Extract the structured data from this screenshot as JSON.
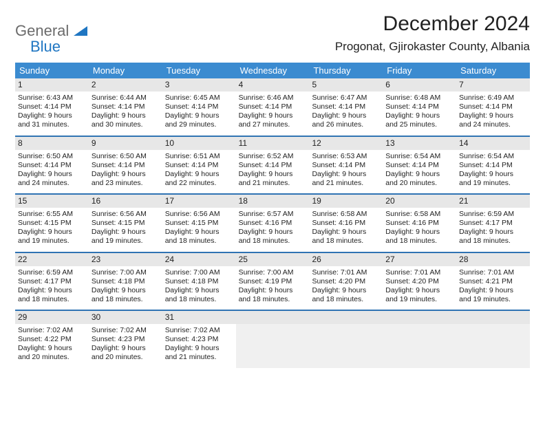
{
  "brand": {
    "general": "General",
    "blue": "Blue"
  },
  "title": "December 2024",
  "location": "Progonat, Gjirokaster County, Albania",
  "dow": [
    "Sunday",
    "Monday",
    "Tuesday",
    "Wednesday",
    "Thursday",
    "Friday",
    "Saturday"
  ],
  "weeks": [
    [
      {
        "n": "1",
        "sr": "Sunrise: 6:43 AM",
        "ss": "Sunset: 4:14 PM",
        "d1": "Daylight: 9 hours",
        "d2": "and 31 minutes."
      },
      {
        "n": "2",
        "sr": "Sunrise: 6:44 AM",
        "ss": "Sunset: 4:14 PM",
        "d1": "Daylight: 9 hours",
        "d2": "and 30 minutes."
      },
      {
        "n": "3",
        "sr": "Sunrise: 6:45 AM",
        "ss": "Sunset: 4:14 PM",
        "d1": "Daylight: 9 hours",
        "d2": "and 29 minutes."
      },
      {
        "n": "4",
        "sr": "Sunrise: 6:46 AM",
        "ss": "Sunset: 4:14 PM",
        "d1": "Daylight: 9 hours",
        "d2": "and 27 minutes."
      },
      {
        "n": "5",
        "sr": "Sunrise: 6:47 AM",
        "ss": "Sunset: 4:14 PM",
        "d1": "Daylight: 9 hours",
        "d2": "and 26 minutes."
      },
      {
        "n": "6",
        "sr": "Sunrise: 6:48 AM",
        "ss": "Sunset: 4:14 PM",
        "d1": "Daylight: 9 hours",
        "d2": "and 25 minutes."
      },
      {
        "n": "7",
        "sr": "Sunrise: 6:49 AM",
        "ss": "Sunset: 4:14 PM",
        "d1": "Daylight: 9 hours",
        "d2": "and 24 minutes."
      }
    ],
    [
      {
        "n": "8",
        "sr": "Sunrise: 6:50 AM",
        "ss": "Sunset: 4:14 PM",
        "d1": "Daylight: 9 hours",
        "d2": "and 24 minutes."
      },
      {
        "n": "9",
        "sr": "Sunrise: 6:50 AM",
        "ss": "Sunset: 4:14 PM",
        "d1": "Daylight: 9 hours",
        "d2": "and 23 minutes."
      },
      {
        "n": "10",
        "sr": "Sunrise: 6:51 AM",
        "ss": "Sunset: 4:14 PM",
        "d1": "Daylight: 9 hours",
        "d2": "and 22 minutes."
      },
      {
        "n": "11",
        "sr": "Sunrise: 6:52 AM",
        "ss": "Sunset: 4:14 PM",
        "d1": "Daylight: 9 hours",
        "d2": "and 21 minutes."
      },
      {
        "n": "12",
        "sr": "Sunrise: 6:53 AM",
        "ss": "Sunset: 4:14 PM",
        "d1": "Daylight: 9 hours",
        "d2": "and 21 minutes."
      },
      {
        "n": "13",
        "sr": "Sunrise: 6:54 AM",
        "ss": "Sunset: 4:14 PM",
        "d1": "Daylight: 9 hours",
        "d2": "and 20 minutes."
      },
      {
        "n": "14",
        "sr": "Sunrise: 6:54 AM",
        "ss": "Sunset: 4:14 PM",
        "d1": "Daylight: 9 hours",
        "d2": "and 19 minutes."
      }
    ],
    [
      {
        "n": "15",
        "sr": "Sunrise: 6:55 AM",
        "ss": "Sunset: 4:15 PM",
        "d1": "Daylight: 9 hours",
        "d2": "and 19 minutes."
      },
      {
        "n": "16",
        "sr": "Sunrise: 6:56 AM",
        "ss": "Sunset: 4:15 PM",
        "d1": "Daylight: 9 hours",
        "d2": "and 19 minutes."
      },
      {
        "n": "17",
        "sr": "Sunrise: 6:56 AM",
        "ss": "Sunset: 4:15 PM",
        "d1": "Daylight: 9 hours",
        "d2": "and 18 minutes."
      },
      {
        "n": "18",
        "sr": "Sunrise: 6:57 AM",
        "ss": "Sunset: 4:16 PM",
        "d1": "Daylight: 9 hours",
        "d2": "and 18 minutes."
      },
      {
        "n": "19",
        "sr": "Sunrise: 6:58 AM",
        "ss": "Sunset: 4:16 PM",
        "d1": "Daylight: 9 hours",
        "d2": "and 18 minutes."
      },
      {
        "n": "20",
        "sr": "Sunrise: 6:58 AM",
        "ss": "Sunset: 4:16 PM",
        "d1": "Daylight: 9 hours",
        "d2": "and 18 minutes."
      },
      {
        "n": "21",
        "sr": "Sunrise: 6:59 AM",
        "ss": "Sunset: 4:17 PM",
        "d1": "Daylight: 9 hours",
        "d2": "and 18 minutes."
      }
    ],
    [
      {
        "n": "22",
        "sr": "Sunrise: 6:59 AM",
        "ss": "Sunset: 4:17 PM",
        "d1": "Daylight: 9 hours",
        "d2": "and 18 minutes."
      },
      {
        "n": "23",
        "sr": "Sunrise: 7:00 AM",
        "ss": "Sunset: 4:18 PM",
        "d1": "Daylight: 9 hours",
        "d2": "and 18 minutes."
      },
      {
        "n": "24",
        "sr": "Sunrise: 7:00 AM",
        "ss": "Sunset: 4:18 PM",
        "d1": "Daylight: 9 hours",
        "d2": "and 18 minutes."
      },
      {
        "n": "25",
        "sr": "Sunrise: 7:00 AM",
        "ss": "Sunset: 4:19 PM",
        "d1": "Daylight: 9 hours",
        "d2": "and 18 minutes."
      },
      {
        "n": "26",
        "sr": "Sunrise: 7:01 AM",
        "ss": "Sunset: 4:20 PM",
        "d1": "Daylight: 9 hours",
        "d2": "and 18 minutes."
      },
      {
        "n": "27",
        "sr": "Sunrise: 7:01 AM",
        "ss": "Sunset: 4:20 PM",
        "d1": "Daylight: 9 hours",
        "d2": "and 19 minutes."
      },
      {
        "n": "28",
        "sr": "Sunrise: 7:01 AM",
        "ss": "Sunset: 4:21 PM",
        "d1": "Daylight: 9 hours",
        "d2": "and 19 minutes."
      }
    ],
    [
      {
        "n": "29",
        "sr": "Sunrise: 7:02 AM",
        "ss": "Sunset: 4:22 PM",
        "d1": "Daylight: 9 hours",
        "d2": "and 20 minutes."
      },
      {
        "n": "30",
        "sr": "Sunrise: 7:02 AM",
        "ss": "Sunset: 4:23 PM",
        "d1": "Daylight: 9 hours",
        "d2": "and 20 minutes."
      },
      {
        "n": "31",
        "sr": "Sunrise: 7:02 AM",
        "ss": "Sunset: 4:23 PM",
        "d1": "Daylight: 9 hours",
        "d2": "and 21 minutes."
      },
      {
        "empty": true
      },
      {
        "empty": true
      },
      {
        "empty": true
      },
      {
        "empty": true
      }
    ]
  ]
}
